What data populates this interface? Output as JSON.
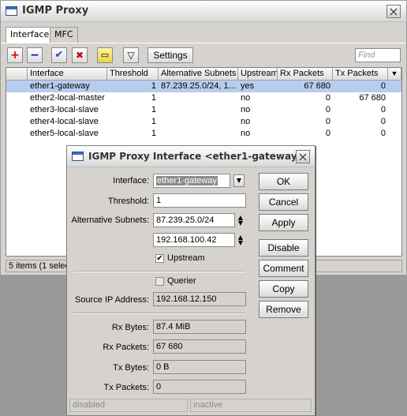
{
  "main_window": {
    "title": "IGMP Proxy",
    "close": "×",
    "tabs": [
      {
        "label": "Interface"
      },
      {
        "label": "MFC"
      }
    ],
    "toolbar": {
      "add": "+",
      "remove": "−",
      "enable": "✔",
      "disable": "✖",
      "comment": "▭",
      "filter": "▽",
      "settings_label": "Settings",
      "find_placeholder": "Find"
    },
    "table": {
      "columns": [
        "Interface",
        "Threshold",
        "Alternative Subnets",
        "Upstream",
        "Rx Packets",
        "Tx Packets"
      ],
      "rows": [
        {
          "interface": "ether1-gateway",
          "threshold": "1",
          "alt_subnets": "87.239.25.0/24, 1...",
          "upstream": "yes",
          "rx": "67 680",
          "tx": "0"
        },
        {
          "interface": "ether2-local-master",
          "threshold": "1",
          "alt_subnets": "",
          "upstream": "no",
          "rx": "0",
          "tx": "67 680"
        },
        {
          "interface": "ether3-local-slave",
          "threshold": "1",
          "alt_subnets": "",
          "upstream": "no",
          "rx": "0",
          "tx": "0"
        },
        {
          "interface": "ether4-local-slave",
          "threshold": "1",
          "alt_subnets": "",
          "upstream": "no",
          "rx": "0",
          "tx": "0"
        },
        {
          "interface": "ether5-local-slave",
          "threshold": "1",
          "alt_subnets": "",
          "upstream": "no",
          "rx": "0",
          "tx": "0"
        }
      ]
    },
    "status": "5 items (1 select"
  },
  "dialog": {
    "title": "IGMP Proxy Interface <ether1-gateway>",
    "close": "×",
    "labels": {
      "interface": "Interface:",
      "threshold": "Threshold:",
      "alt_subnets": "Alternative Subnets:",
      "upstream": "Upstream",
      "querier": "Querier",
      "source_ip": "Source IP Address:",
      "rx_bytes": "Rx Bytes:",
      "rx_packets": "Rx Packets:",
      "tx_bytes": "Tx Bytes:",
      "tx_packets": "Tx Packets:"
    },
    "values": {
      "interface": "ether1-gateway",
      "threshold": "1",
      "alt_subnet_1": "87.239.25.0/24",
      "alt_subnet_2": "192.168.100.42",
      "upstream_checked": "✔",
      "source_ip": "192.168.12.150",
      "rx_bytes": "87.4 MiB",
      "rx_packets": "67 680",
      "tx_bytes": "0 B",
      "tx_packets": "0"
    },
    "buttons": {
      "ok": "OK",
      "cancel": "Cancel",
      "apply": "Apply",
      "disable": "Disable",
      "comment": "Comment",
      "copy": "Copy",
      "remove": "Remove"
    },
    "status_left": "disabled",
    "status_right": "inactive"
  },
  "colors": {
    "selected_row": "#b8cdee",
    "add": "#d40000",
    "remove": "#0000c8",
    "enable": "#1a3fd0",
    "disable": "#d40000"
  }
}
